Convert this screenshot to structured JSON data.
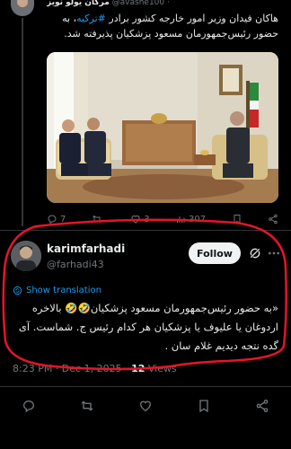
{
  "parent_post": {
    "author_name": "مرکان یولو نویز",
    "author_handle": "@avashe100 ·",
    "text_part1": "هاکان فیدان وزیر امور خارجه کشور برادر ",
    "hashtag": "#ترکیه",
    "text_part2": "، به حضور رئیس‌جمهورمان مسعود پزشکیان پذیرفته شد.",
    "counts": {
      "reply": "7",
      "repost": "",
      "like": "3",
      "views": "307"
    }
  },
  "quote_tweet": {
    "author_name": "karimfarhadi",
    "author_handle": "@farhadi43",
    "follow_label": "Follow",
    "translate_label": "Show translation",
    "text": "«به حضور رئیس‌جمهورمان مسعود پزشکیان🤣🤣 بالاخره اردوغان یا علیوف یا پزشکیان هر کدام رئیس ج. شماست. آی گده نتجه دیدیم غلام سان .",
    "time": "8:23 PM · Dec 1, 2025 · ",
    "views_count": "12",
    "views_label": " Views"
  },
  "icons": [
    "reply-icon",
    "repost-icon",
    "like-icon",
    "views-icon",
    "bookmark-icon",
    "share-icon",
    "grok-icon",
    "more-icon",
    "translate-icon"
  ],
  "colors": {
    "background": "#000000",
    "text": "#e7e9ea",
    "muted": "#71767b",
    "accent": "#1d9bf0",
    "annotation": "#e8132b"
  }
}
